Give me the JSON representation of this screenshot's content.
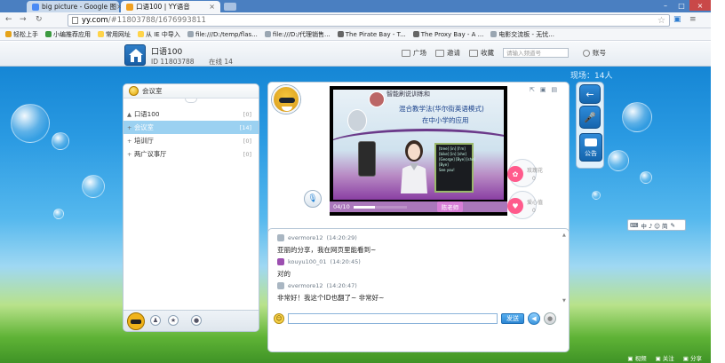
{
  "browser": {
    "tabs": [
      {
        "title": "big picture - Google 图",
        "favicon_color": "#4a8af4"
      },
      {
        "title": "口语100 | YY语音",
        "favicon_color": "#f0a020"
      }
    ],
    "url_host": "yy.com",
    "url_path": "/#11803788/1676993811",
    "bookmarks": [
      {
        "label": "轻松上手",
        "color": "#e5a31a"
      },
      {
        "label": "小编推荐应用",
        "color": "#3c9a40"
      },
      {
        "label": "常用网址",
        "color": "#ffd44a"
      },
      {
        "label": "从 IE 中导入",
        "color": "#ffd44a"
      },
      {
        "label": "file:///D:/temp/flas...",
        "color": "#9aa6b2"
      },
      {
        "label": "file:///D:/代理销售...",
        "color": "#9aa6b2"
      },
      {
        "label": "The Pirate Bay - T...",
        "color": "#666666"
      },
      {
        "label": "The Proxy Bay - A ...",
        "color": "#666666"
      },
      {
        "label": "电影交流板 - 无忧...",
        "color": "#9aa6b2"
      }
    ]
  },
  "channel": {
    "name": "口语100",
    "id_label": "ID",
    "id": "11803788",
    "online_label": "在线",
    "online_count": "14"
  },
  "topnav": {
    "plaza": "广场",
    "invite": "邀请",
    "favorite": "收藏",
    "search_placeholder": "请输入频道号",
    "account": "账号"
  },
  "online_header": {
    "label": "现场：",
    "count": "14人"
  },
  "left_panel": {
    "title": "会议室",
    "rooms": [
      {
        "expander": "▲",
        "name": "口语100",
        "count": "[0]",
        "active": false
      },
      {
        "expander": "+",
        "name": "会议室",
        "count": "[14]",
        "active": true
      },
      {
        "expander": "+",
        "name": "培训厅",
        "count": "[0]",
        "active": false
      },
      {
        "expander": "+",
        "name": "两广议事厅",
        "count": "[0]",
        "active": false
      }
    ]
  },
  "video": {
    "slide_line1": "智能刷说训练和",
    "slide_line2": "混合教学法(华尔街英语模式)",
    "slide_line3": "在中小学的应用",
    "progress_label": "04/10",
    "presenter": "陈老师",
    "screen_text": "[tree] [in] [I'm]\n[bike] [in] [she]\n[George] [Bye] [she]\n[Bye]\nSee you!"
  },
  "gifts": [
    {
      "label": "玫瑰花",
      "count": "0"
    },
    {
      "label": "爱心值",
      "count": "0"
    }
  ],
  "chat": {
    "messages": [
      {
        "user": "evermore12",
        "time": "(14:20:29)",
        "text": "亚丽的分享，我在网页里能看到~"
      },
      {
        "user": "kouyu100_01",
        "time": "(14:20:45)",
        "text": "对的"
      },
      {
        "user": "evermore12",
        "time": "(14:20:47)",
        "text": "非常好！我这个ID也翻了~ 非常好~"
      }
    ],
    "input_value": "",
    "send_label": "发送"
  },
  "right_col": {
    "notice_label": "公告"
  },
  "mini_tools": {
    "text": "中 ♪ ☺ 简"
  },
  "statusbar": {
    "items": [
      "视频",
      "关注",
      "分享"
    ]
  },
  "colors": {
    "accent": "#2d86d3",
    "active_room": "#9bd1f1",
    "sky": "#2a9ae2",
    "grass": "#5fb336"
  }
}
